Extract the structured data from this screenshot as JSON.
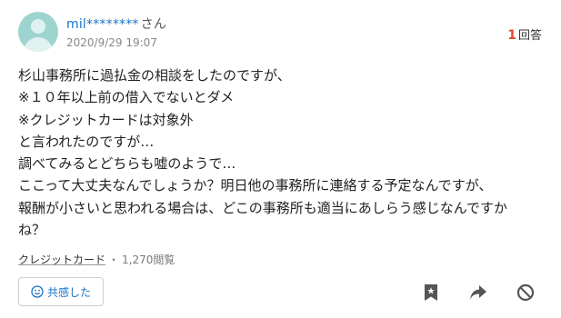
{
  "user": {
    "name": "mil********",
    "suffix": "さん",
    "date": "2020/9/29 19:07"
  },
  "answers": {
    "count": "1",
    "label": "回答"
  },
  "question": {
    "lines": [
      "杉山事務所に過払金の相談をしたのですが、",
      "※１０年以上前の借入でないとダメ",
      "※クレジットカードは対象外",
      "と言われたのですが…",
      "調べてみるとどちらも嘘のようで…",
      "ここって大丈夫なんでしょうか？明日他の事務所に連絡する予定なんですが、",
      "報酬が小さいと思われる場合は、どこの事務所も適当にあしらう感じなんですか",
      "ね？"
    ]
  },
  "meta": {
    "category": "クレジットカード",
    "separator": "・",
    "views": "1,270閲覧"
  },
  "actions": {
    "empathy_label": "共感した"
  },
  "icons": {
    "avatar": "user-avatar-icon",
    "empathy": "smile-icon",
    "bookmark": "bookmark-icon",
    "share": "share-arrow-icon",
    "hide": "block-icon"
  },
  "colors": {
    "link": "#1a73c9",
    "answer_count": "#e8442e",
    "icon_gray": "#555555"
  }
}
